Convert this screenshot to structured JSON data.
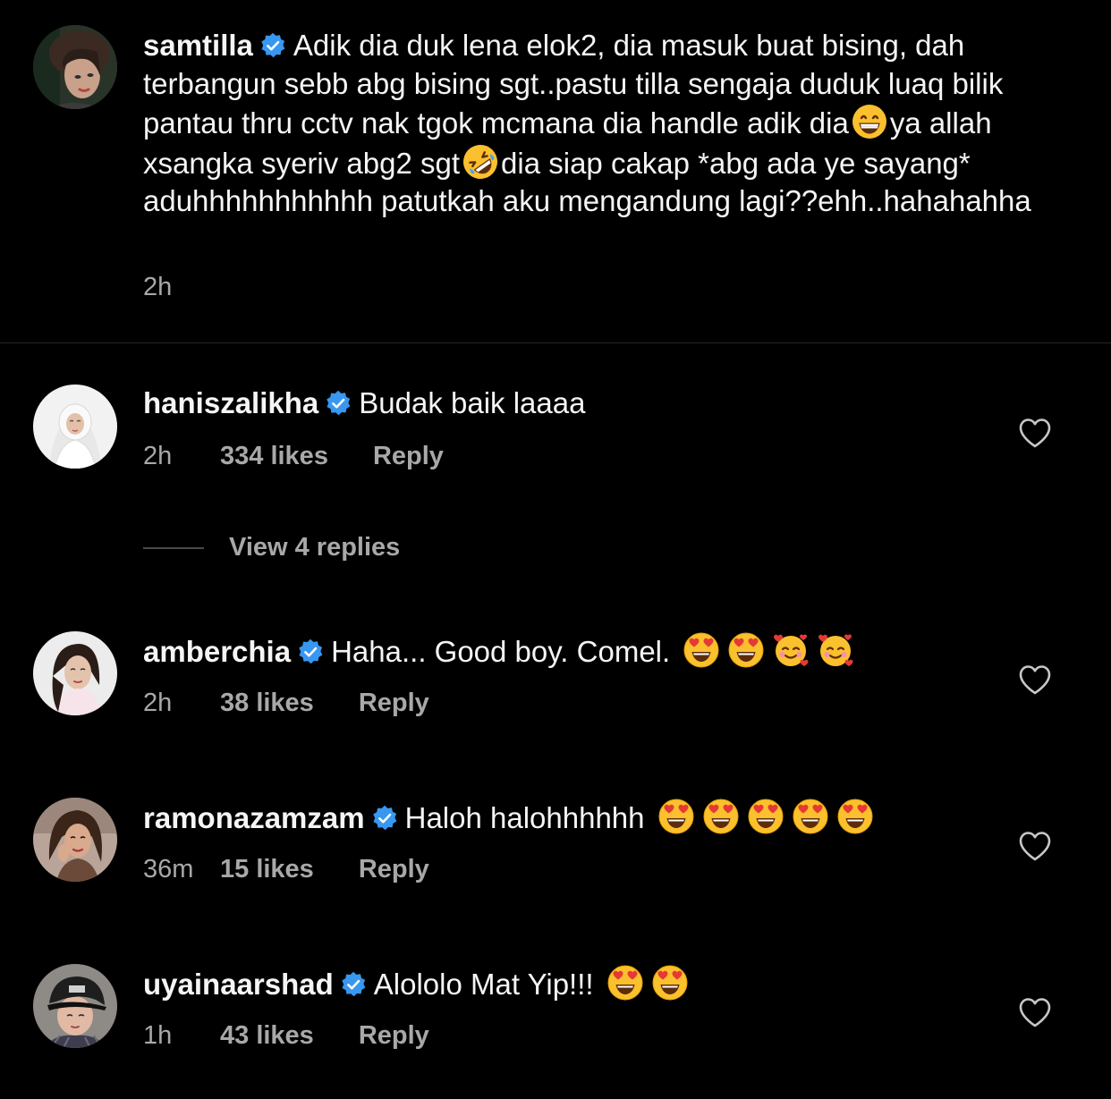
{
  "caption": {
    "username": "samtilla",
    "verified": true,
    "text_parts": [
      "Adik dia duk lena elok2, dia masuk buat bising, dah terbangun sebb abg bising sgt..pastu tilla sengaja duduk luaq bilik pantau thru cctv nak tgok mcmana dia handle adik dia",
      "ya allah xsangka syeriv abg2 sgt",
      "dia siap cakap *abg ada ye sayang* aduhhhhhhhhhhh patutkah aku mengandung lagi??ehh..hahahahha"
    ],
    "emojis": [
      "grinning-face",
      "rolling-on-floor-laughing"
    ],
    "time": "2h"
  },
  "comments": [
    {
      "username": "haniszalikha",
      "text": "Budak baik laaaa",
      "emojis": [],
      "time": "2h",
      "likes": "334 likes",
      "reply_label": "Reply",
      "view_replies": "View 4 replies"
    },
    {
      "username": "amberchia",
      "text": "Haha... Good boy. Comel.",
      "emojis": [
        "heart-eyes",
        "heart-eyes",
        "smiling-face-with-hearts",
        "smiling-face-with-hearts"
      ],
      "time": "2h",
      "likes": "38 likes",
      "reply_label": "Reply"
    },
    {
      "username": "ramonazamzam",
      "text": "Haloh halohhhhhh",
      "emojis": [
        "heart-eyes",
        "heart-eyes",
        "heart-eyes",
        "heart-eyes",
        "heart-eyes"
      ],
      "time": "36m",
      "likes": "15 likes",
      "reply_label": "Reply"
    },
    {
      "username": "uyainaarshad",
      "text": "Alololo Mat Yip!!!",
      "emojis": [
        "heart-eyes",
        "heart-eyes"
      ],
      "time": "1h",
      "likes": "43 likes",
      "reply_label": "Reply"
    }
  ],
  "colors": {
    "background": "#000000",
    "text": "#f5f5f5",
    "secondary": "#a8a8a8",
    "verified_blue": "#3897f0",
    "divider": "#262626"
  },
  "icons": {
    "verified": "verified-badge-icon",
    "like": "heart-outline-icon"
  }
}
